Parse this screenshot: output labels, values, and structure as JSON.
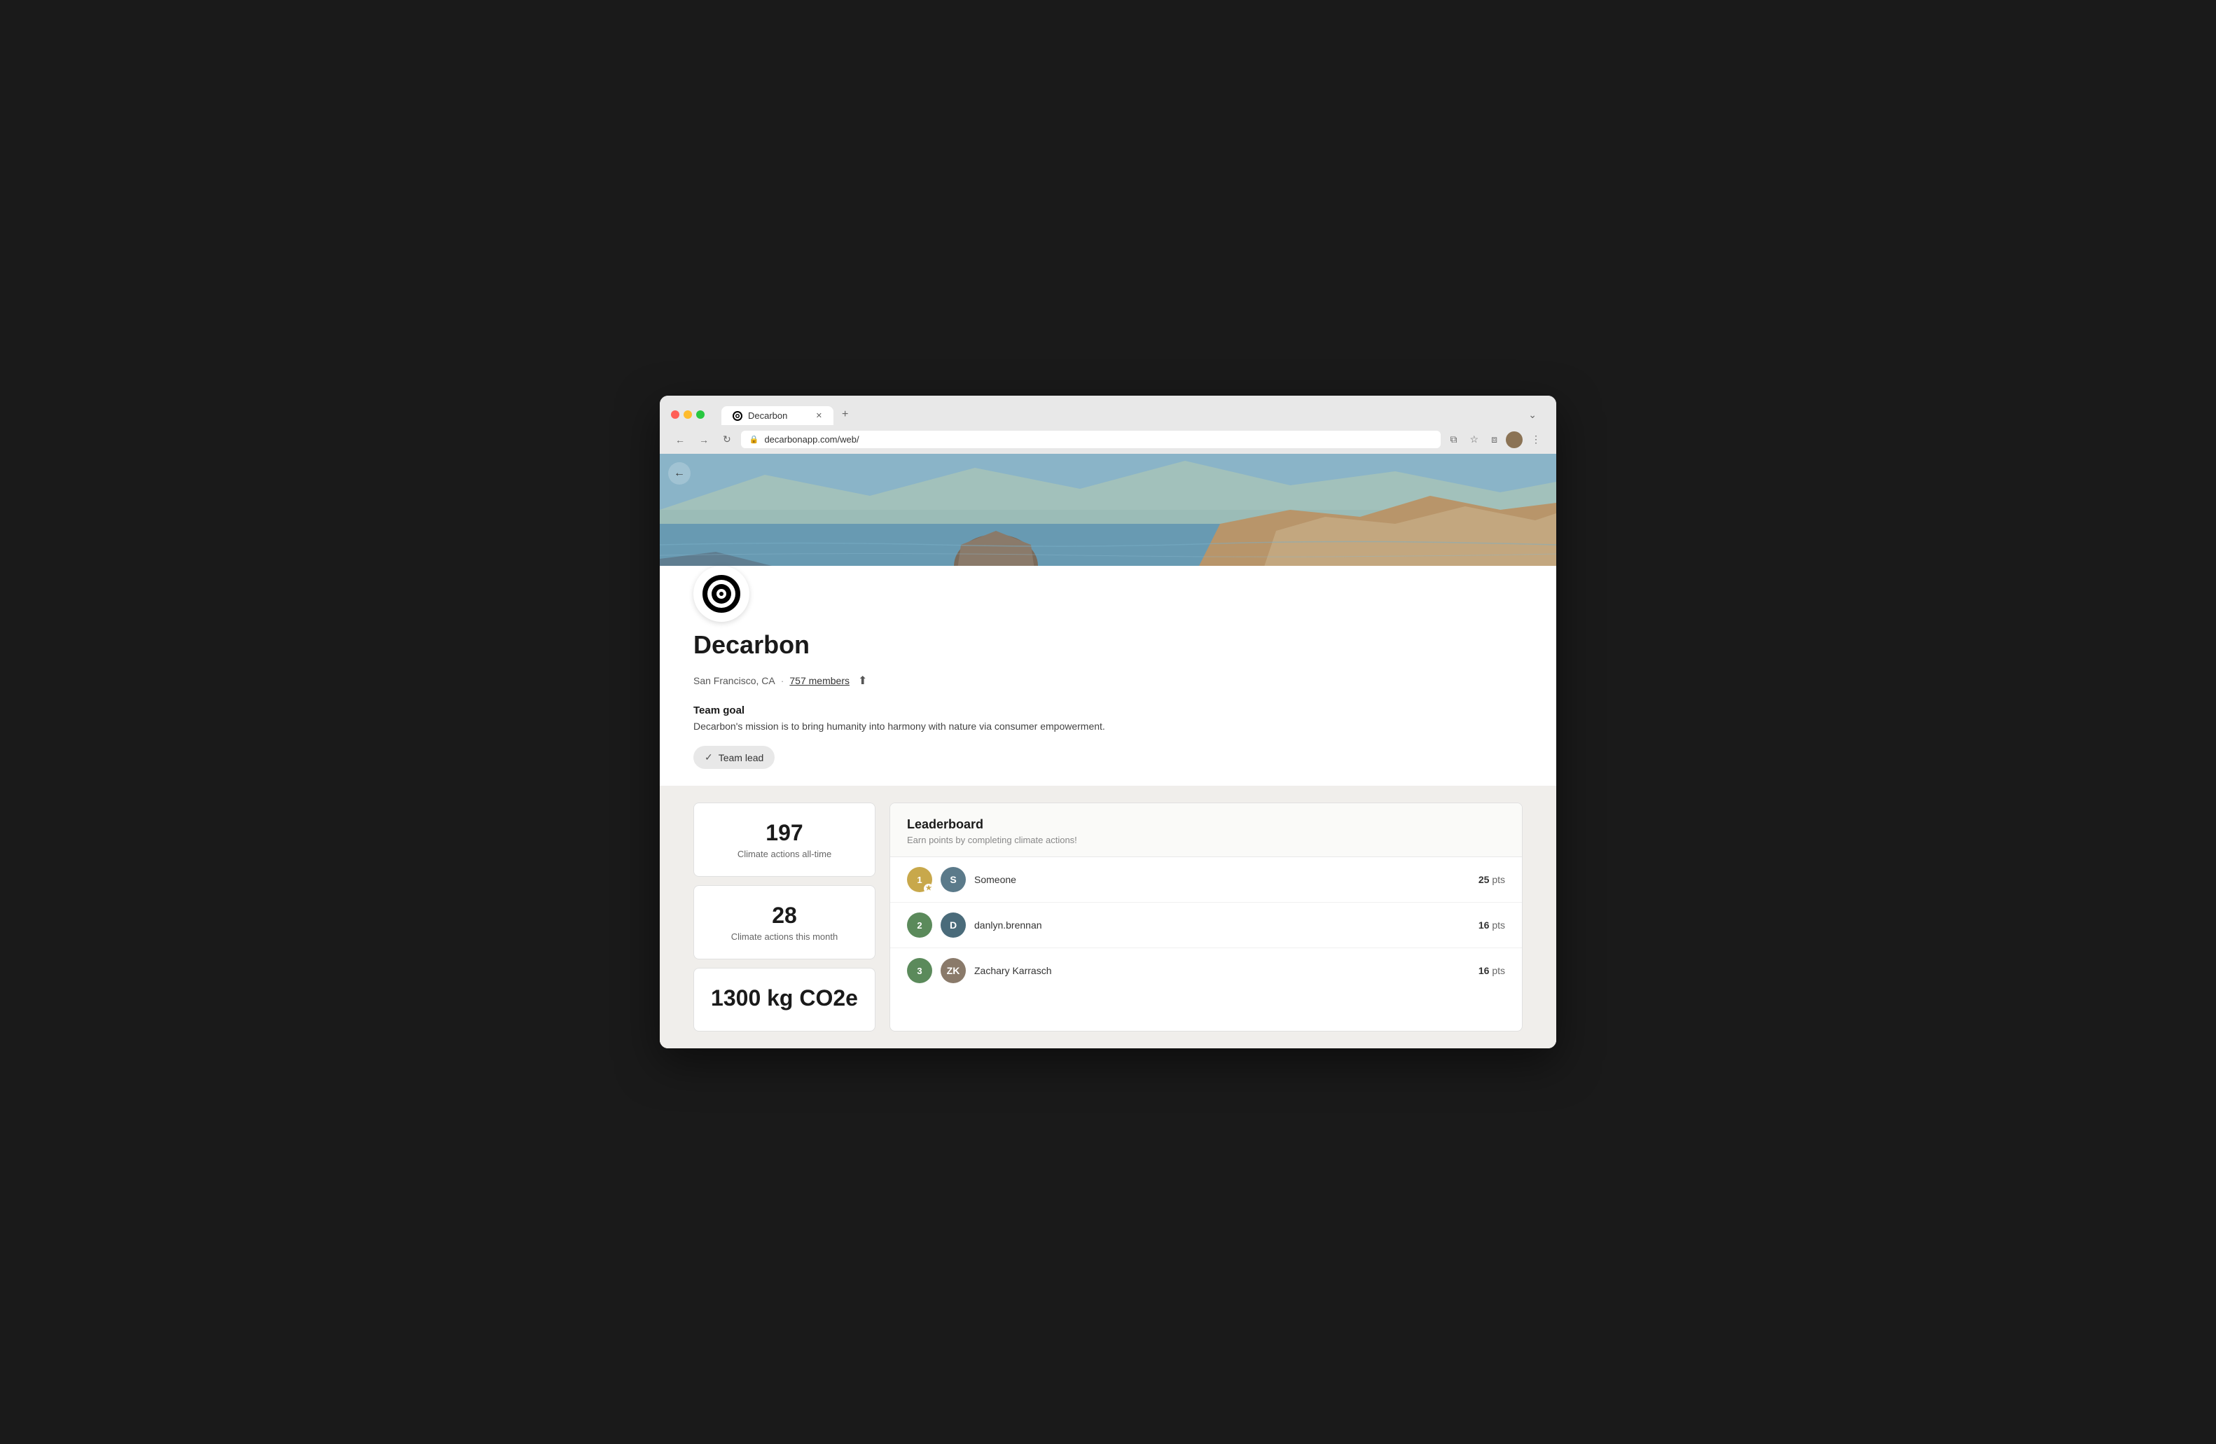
{
  "browser": {
    "tab_title": "Decarbon",
    "url": "decarbonapp.com/web/",
    "new_tab_symbol": "+",
    "dropdown_symbol": "⌄",
    "nav": {
      "back": "←",
      "forward": "→",
      "refresh": "↻",
      "back_page": "←"
    },
    "toolbar": {
      "external_link": "⧉",
      "bookmark": "☆",
      "extensions": "⧉",
      "profile": "",
      "menu": "⋮"
    }
  },
  "page": {
    "back_label": "←",
    "org_name": "Decarbon",
    "location": "San Francisco, CA",
    "members_count": "757 members",
    "team_goal_label": "Team goal",
    "team_goal_text": "Decarbon's mission is to bring humanity into harmony with nature via consumer empowerment.",
    "team_lead_label": "Team lead",
    "stats": [
      {
        "number": "197",
        "label": "Climate actions all-time"
      },
      {
        "number": "28",
        "label": "Climate actions this month"
      },
      {
        "number": "1300 kg CO2e",
        "label": ""
      }
    ],
    "leaderboard": {
      "title": "Leaderboard",
      "subtitle": "Earn points by completing climate actions!",
      "entries": [
        {
          "rank": "1",
          "name": "Someone",
          "avatar_letter": "S",
          "points": "25",
          "pts_label": "pts",
          "avatar_type": "letter"
        },
        {
          "rank": "2",
          "name": "danlyn.brennan",
          "avatar_letter": "D",
          "points": "16",
          "pts_label": "pts",
          "avatar_type": "letter"
        },
        {
          "rank": "3",
          "name": "Zachary Karrasch",
          "avatar_letter": "ZK",
          "points": "16",
          "pts_label": "pts",
          "avatar_type": "image"
        }
      ]
    }
  }
}
